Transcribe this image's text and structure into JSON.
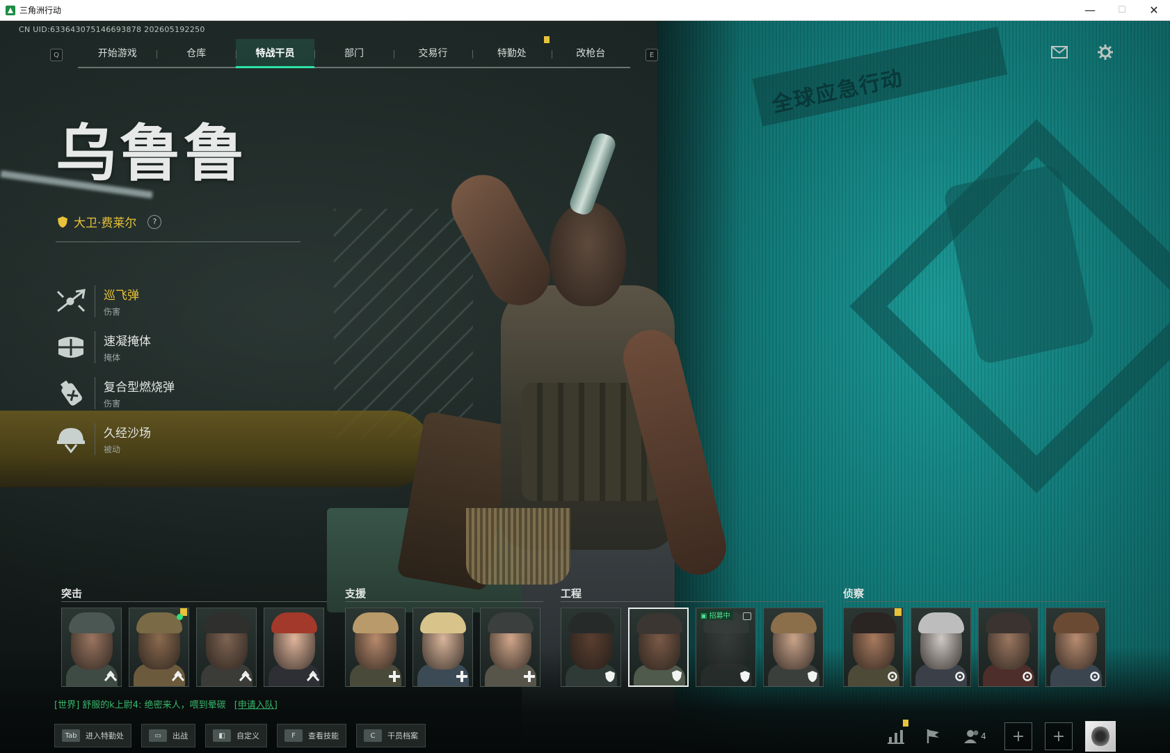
{
  "window": {
    "title": "三角洲行动",
    "minimize": "—",
    "maximize": "☐",
    "close": "✕"
  },
  "uid": "CN UID:63364307514669387​8 202605192250",
  "nav": {
    "left_key": "Q",
    "right_key": "E",
    "tabs": [
      "开始游戏",
      "仓库",
      "特战干员",
      "部门",
      "交易行",
      "特勤处",
      "改枪台"
    ],
    "active_tab": "特战干员"
  },
  "background": {
    "banner": "全球应急行动"
  },
  "operator": {
    "codename": "乌鲁鲁",
    "real_name": "大卫·费莱尔",
    "help": "?"
  },
  "abilities": [
    {
      "name": "巡飞弹",
      "type": "伤害",
      "active": true,
      "icon": "loitering-munition-icon"
    },
    {
      "name": "速凝掩体",
      "type": "掩体",
      "active": false,
      "icon": "cover-icon"
    },
    {
      "name": "复合型燃烧弹",
      "type": "伤害",
      "active": false,
      "icon": "incendiary-icon"
    },
    {
      "name": "久经沙场",
      "type": "被动",
      "active": false,
      "icon": "helmet-icon"
    }
  ],
  "roster": {
    "groups": [
      {
        "title": "突击",
        "role_icon": "assault-chevron-icon",
        "operators": [
          {
            "id": "assault-1",
            "face": "#9a7560",
            "gear": "#3e4b45",
            "helmet": "#4b5752"
          },
          {
            "id": "assault-2",
            "face": "#8b6a4e",
            "gear": "#6b5a3c",
            "helmet": "#7a6a45",
            "alert": true,
            "online": true
          },
          {
            "id": "assault-3",
            "face": "#7e6352",
            "gear": "#3b3b38",
            "helmet": "#2f2f2d"
          },
          {
            "id": "assault-4",
            "face": "#e0b59c",
            "gear": "#2d2f35",
            "helmet": "#a2392a"
          }
        ]
      },
      {
        "title": "支援",
        "role_icon": "support-plus-icon",
        "operators": [
          {
            "id": "support-1",
            "face": "#b88a6c",
            "gear": "#4a4a3b",
            "helmet": "#b99a6a"
          },
          {
            "id": "support-2",
            "face": "#d9b59a",
            "gear": "#3c4a55",
            "helmet": "#d8c48a"
          },
          {
            "id": "support-3",
            "face": "#d0a68a",
            "gear": "#57554a",
            "helmet": "#3b3f3e"
          }
        ]
      },
      {
        "title": "工程",
        "role_icon": "engineer-shield-icon",
        "operators": [
          {
            "id": "engineer-1",
            "face": "#5a3e30",
            "gear": "#2f3a36",
            "helmet": "#262b2a"
          },
          {
            "id": "engineer-2",
            "face": "#7a5a47",
            "gear": "#4f5a4d",
            "helmet": "#3b3632",
            "selected": true
          },
          {
            "id": "engineer-3",
            "face": "#444b48",
            "gear": "#2d3331",
            "helmet": "#3a3f3d",
            "recruiting": "招募中",
            "locked": true
          },
          {
            "id": "engineer-4",
            "face": "#caa48a",
            "gear": "#3b3f3b",
            "helmet": "#8a6f4a"
          }
        ]
      },
      {
        "title": "侦察",
        "role_icon": "recon-scope-icon",
        "operators": [
          {
            "id": "recon-1",
            "face": "#a87a5e",
            "gear": "#4d4a38",
            "helmet": "#2a2422",
            "alert": true
          },
          {
            "id": "recon-2",
            "face": "#cfc9c4",
            "gear": "#3a3f48",
            "helmet": "#bdbdbd"
          },
          {
            "id": "recon-3",
            "face": "#9a7660",
            "gear": "#4e2e2a",
            "helmet": "#3b3330"
          },
          {
            "id": "recon-4",
            "face": "#b88c70",
            "gear": "#3b4550",
            "helmet": "#6b4a33"
          }
        ]
      }
    ]
  },
  "chat": {
    "text": "[世界] 舒服的k上尉4: 绝密来人，喂到晕碳",
    "action": "[申请入队]"
  },
  "hints": [
    {
      "key": "Tab",
      "label": "进入特勤处"
    },
    {
      "key": "▭",
      "label": "出战"
    },
    {
      "key": "◧",
      "label": "自定义"
    },
    {
      "key": "F",
      "label": "查看技能"
    },
    {
      "key": "C",
      "label": "干员档案"
    }
  ],
  "bottom_right": {
    "squad_count": "4",
    "plus": "+"
  },
  "colors": {
    "accent_green": "#2fe3a4",
    "highlight_yellow": "#e8c23a",
    "teal_wall": "#1c9b98"
  }
}
